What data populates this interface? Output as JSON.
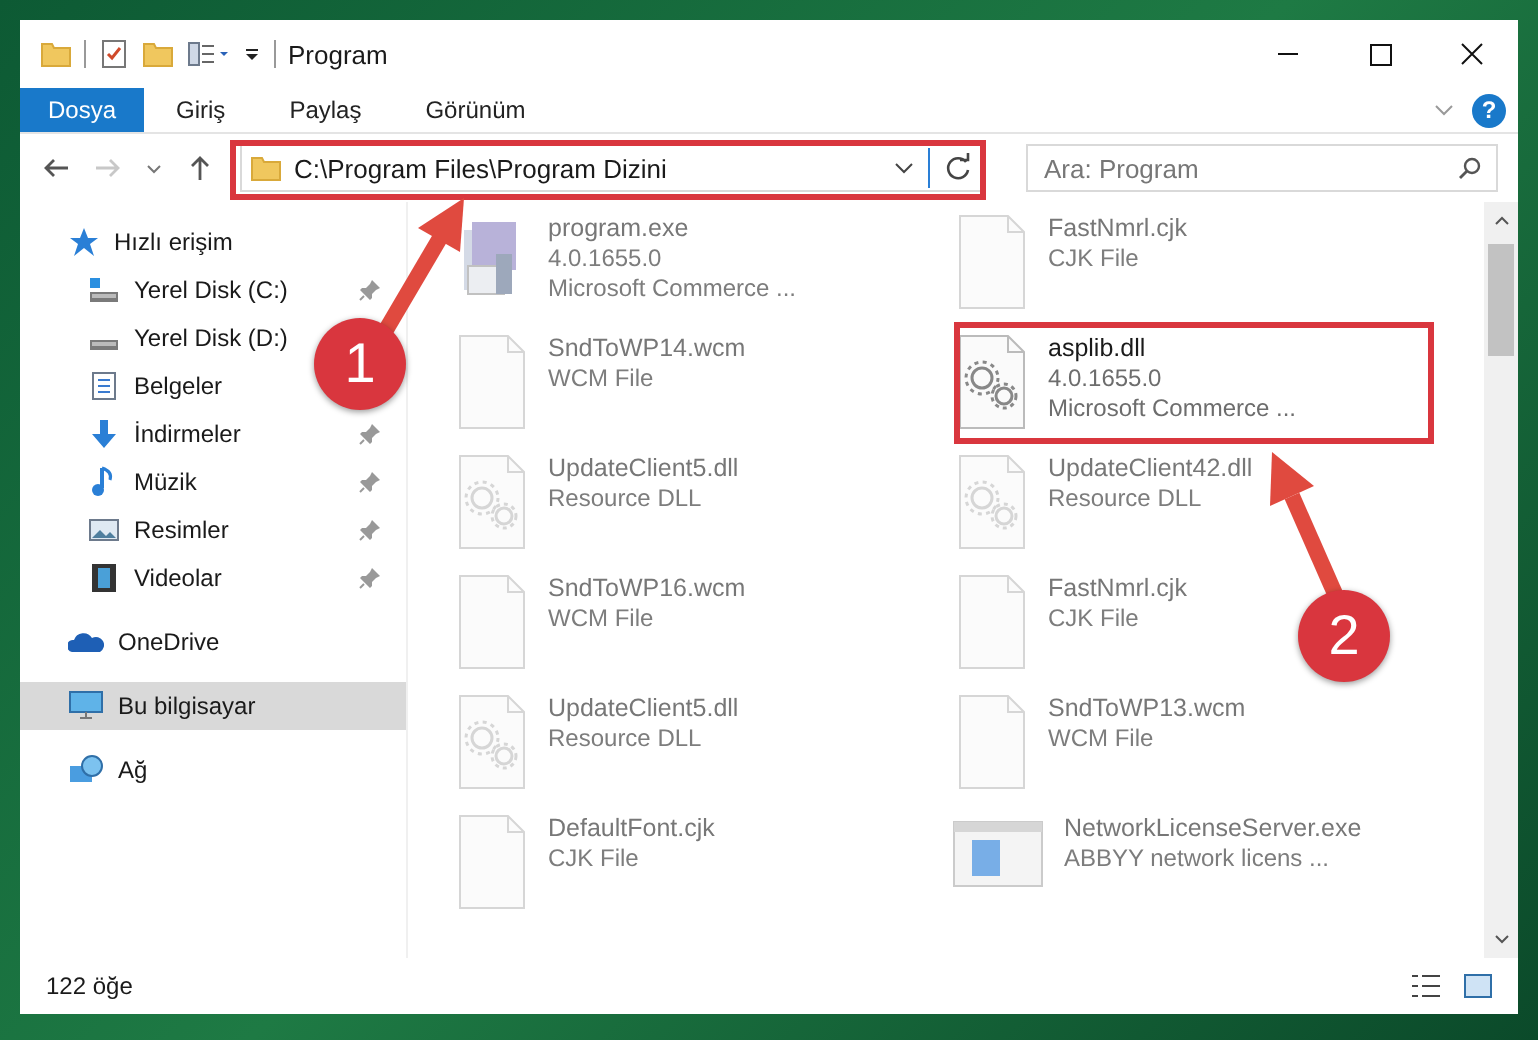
{
  "window": {
    "title": "Program"
  },
  "ribbon_tabs": [
    {
      "label": "Dosya",
      "selected": true
    },
    {
      "label": "Giriş",
      "selected": false
    },
    {
      "label": "Paylaş",
      "selected": false
    },
    {
      "label": "Görünüm",
      "selected": false
    }
  ],
  "help": {
    "label": "?"
  },
  "address": {
    "path": "C:\\Program Files\\Program Dizini"
  },
  "search": {
    "placeholder": "Ara: Program"
  },
  "sidebar": {
    "items": [
      {
        "label": "Hızlı erişim",
        "selected": false,
        "children": [
          {
            "label": "Yerel Disk (C:)",
            "pinned": true,
            "selected": false
          },
          {
            "label": "Yerel Disk (D:)",
            "pinned": false,
            "selected": false
          },
          {
            "label": "Belgeler",
            "pinned": false,
            "selected": false
          },
          {
            "label": "İndirmeler",
            "pinned": true,
            "selected": false
          },
          {
            "label": "Müzik",
            "pinned": true,
            "selected": false
          },
          {
            "label": "Resimler",
            "pinned": true,
            "selected": false
          },
          {
            "label": "Videolar",
            "pinned": true,
            "selected": false
          }
        ]
      },
      {
        "label": "OneDrive",
        "selected": false
      },
      {
        "label": "Bu bilgisayar",
        "selected": true
      },
      {
        "label": "Ağ",
        "selected": false
      }
    ]
  },
  "files": [
    {
      "name": "program.exe",
      "details": [
        "4.0.1655.0",
        "Microsoft Commerce ..."
      ],
      "kind": "exe",
      "blurred": true
    },
    {
      "name": "FastNmrl.cjk",
      "details": [
        "CJK File"
      ],
      "kind": "blank",
      "blurred": true
    },
    {
      "name": "SndToWP14.wcm",
      "details": [
        "WCM File"
      ],
      "kind": "blank",
      "blurred": true
    },
    {
      "name": "asplib.dll",
      "details": [
        "4.0.1655.0",
        "Microsoft Commerce ..."
      ],
      "kind": "gear",
      "blurred": false
    },
    {
      "name": "UpdateClient5.dll",
      "details": [
        "Resource DLL"
      ],
      "kind": "dll",
      "blurred": true
    },
    {
      "name": "UpdateClient42.dll",
      "details": [
        "Resource DLL"
      ],
      "kind": "dll",
      "blurred": true
    },
    {
      "name": "SndToWP16.wcm",
      "details": [
        "WCM File"
      ],
      "kind": "blank",
      "blurred": true
    },
    {
      "name": "FastNmrl.cjk",
      "details": [
        "CJK File"
      ],
      "kind": "blank",
      "blurred": true
    },
    {
      "name": "UpdateClient5.dll",
      "details": [
        "Resource DLL"
      ],
      "kind": "dll",
      "blurred": true
    },
    {
      "name": "SndToWP13.wcm",
      "details": [
        "WCM File"
      ],
      "kind": "blank",
      "blurred": true
    },
    {
      "name": "DefaultFont.cjk",
      "details": [
        "CJK File"
      ],
      "kind": "blank",
      "blurred": true
    },
    {
      "name": "NetworkLicenseServer.exe",
      "details": [
        "ABBYY network licens ..."
      ],
      "kind": "app",
      "blurred": true
    }
  ],
  "status_bar": {
    "count": "122 öğe"
  },
  "annotations": [
    {
      "label": "1"
    },
    {
      "label": "2"
    }
  ]
}
